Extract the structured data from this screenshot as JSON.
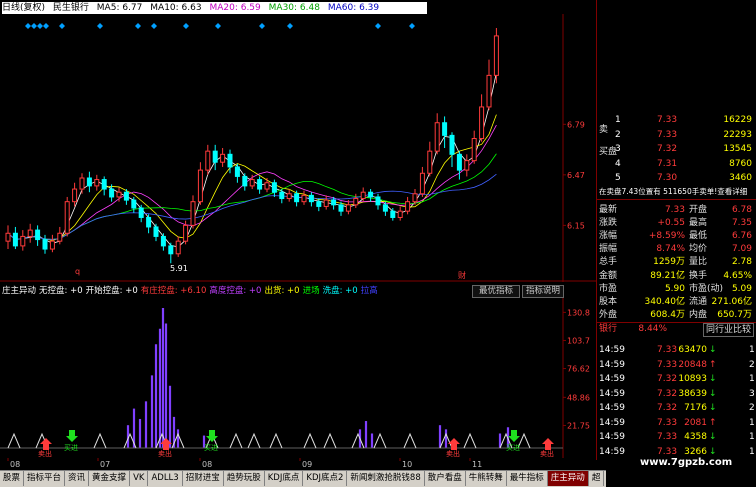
{
  "header": {
    "period": "日线(复权)",
    "stock": "民生银行",
    "ma": [
      {
        "label": "MA5: 6.77",
        "color": "#000000"
      },
      {
        "label": "MA10: 6.63",
        "color": "#000000"
      },
      {
        "label": "MA20: 6.59",
        "color": "#c000c0"
      },
      {
        "label": "MA30: 6.48",
        "color": "#00a000"
      },
      {
        "label": "MA60: 6.39",
        "color": "#0000c0"
      }
    ]
  },
  "main_chart": {
    "price_ticks": [
      "6.79",
      "6.47",
      "6.15"
    ],
    "low_label": "5.91",
    "marker_q": "q",
    "marker_cai": "财"
  },
  "indicator": {
    "items": [
      {
        "label": "庄主异动",
        "color": "#ffffff"
      },
      {
        "label": "无控盘: +0",
        "color": "#ffffff"
      },
      {
        "label": "开始控盘: +0",
        "color": "#ffffff"
      },
      {
        "label": "有庄控盘: +6.10",
        "color": "#ff3b3b"
      },
      {
        "label": "高度控盘: +0",
        "color": "#c040ff"
      },
      {
        "label": "出货: +0",
        "color": "#ffff00"
      },
      {
        "label": "进场",
        "color": "#00ff00"
      },
      {
        "label": "洗盘: +0",
        "color": "#00ffff"
      },
      {
        "label": "拉高",
        "color": "#4040ff"
      }
    ],
    "buttons": [
      "最优指标",
      "指标说明"
    ],
    "y_ticks": [
      "130.8",
      "103.7",
      "76.62",
      "48.86",
      "21.75"
    ],
    "buy_label": "买进",
    "sell_label": "卖出"
  },
  "date_axis": [
    "08",
    "07",
    "08",
    "09",
    "10",
    "11"
  ],
  "quotes": {
    "sell_side_label": "卖",
    "buy_side_label": "买盘",
    "asks": [
      {
        "n": "1",
        "price": "7.33",
        "vol": "16229"
      },
      {
        "n": "2",
        "price": "7.33",
        "vol": "22293"
      },
      {
        "n": "3",
        "price": "7.32",
        "vol": "13545"
      },
      {
        "n": "4",
        "price": "7.31",
        "vol": "8760"
      },
      {
        "n": "5",
        "price": "7.30",
        "vol": "3460"
      }
    ],
    "tick_info": "在卖盘7.43位置有 511650手卖单!查看详细",
    "stats": [
      {
        "l": "最新",
        "v": "7.33",
        "l2": "开盘",
        "v2": "6.78"
      },
      {
        "l": "涨跌",
        "v": "+0.55",
        "l2": "最高",
        "v2": "7.35"
      },
      {
        "l": "涨幅",
        "v": "+8.59%",
        "l2": "最低",
        "v2": "6.76"
      },
      {
        "l": "振幅",
        "v": "8.74%",
        "l2": "均价",
        "v2": "7.09"
      },
      {
        "l": "总手",
        "v": "1259万",
        "l2": "量比",
        "v2": "2.78"
      },
      {
        "l": "金额",
        "v": "89.21亿",
        "l2": "换手",
        "v2": "4.65%"
      },
      {
        "l": "市盈",
        "v": "5.90",
        "l2": "市盈(动)",
        "v2": "5.09"
      },
      {
        "l": "股本",
        "v": "340.40亿",
        "l2": "流通",
        "v2": "271.06亿"
      },
      {
        "l": "外盘",
        "v": "608.4万",
        "l2": "内盘",
        "v2": "650.7万"
      }
    ],
    "sector": {
      "name": "银行",
      "pct": "8.44%",
      "btn": "同行业比较"
    },
    "trades": [
      {
        "t": "14:59",
        "p": "7.33",
        "v": "63470",
        "dir": "down",
        "n": "1"
      },
      {
        "t": "14:59",
        "p": "7.33",
        "v": "20848",
        "dir": "up",
        "n": "2"
      },
      {
        "t": "14:59",
        "p": "7.32",
        "v": "10893",
        "dir": "down",
        "n": "1"
      },
      {
        "t": "14:59",
        "p": "7.32",
        "v": "38639",
        "dir": "down",
        "n": "3"
      },
      {
        "t": "14:59",
        "p": "7.32",
        "v": "7176",
        "dir": "down",
        "n": "2"
      },
      {
        "t": "14:59",
        "p": "7.33",
        "v": "2081",
        "dir": "up",
        "n": "1"
      },
      {
        "t": "14:59",
        "p": "7.33",
        "v": "4358",
        "dir": "down",
        "n": "1"
      },
      {
        "t": "14:59",
        "p": "7.33",
        "v": "3266",
        "dir": "down",
        "n": "1"
      }
    ]
  },
  "bottom_tabs": [
    "股票",
    "指标平台",
    "资讯",
    "黄金支撑",
    "VK",
    "ADLL3",
    "招财进宝",
    "趋势玩股",
    "KDJ底点",
    "KDJ底点2",
    "新闻刺激抢脱钱88",
    "散户看盘",
    "牛熊转舞",
    "最牛指标",
    "庄主异动",
    "超"
  ],
  "active_tab": "庄主异动",
  "watermark": "www.7gpzb.com",
  "colors": {
    "up": "#ff3b3b",
    "down": "#1fe01f",
    "accent": "#800000",
    "volume": "#8040ff"
  },
  "chart_data": {
    "type": "candlestick",
    "y_ticks": [
      6.15,
      6.47,
      6.79
    ],
    "low": 5.91,
    "candles": [
      [
        6.05,
        6.1,
        6.15,
        6.0
      ],
      [
        6.1,
        6.02,
        6.14,
        6.0
      ],
      [
        6.02,
        6.08,
        6.12,
        5.99
      ],
      [
        6.08,
        6.12,
        6.16,
        6.04
      ],
      [
        6.12,
        6.06,
        6.15,
        6.02
      ],
      [
        6.06,
        6.0,
        6.09,
        5.97
      ],
      [
        6.0,
        6.05,
        6.09,
        5.98
      ],
      [
        6.05,
        6.1,
        6.14,
        6.03
      ],
      [
        6.1,
        6.3,
        6.33,
        6.08
      ],
      [
        6.3,
        6.38,
        6.42,
        6.27
      ],
      [
        6.38,
        6.45,
        6.48,
        6.35
      ],
      [
        6.45,
        6.4,
        6.49,
        6.36
      ],
      [
        6.4,
        6.44,
        6.47,
        6.37
      ],
      [
        6.44,
        6.38,
        6.46,
        6.34
      ],
      [
        6.38,
        6.33,
        6.41,
        6.3
      ],
      [
        6.33,
        6.36,
        6.39,
        6.3
      ],
      [
        6.36,
        6.31,
        6.38,
        6.28
      ],
      [
        6.31,
        6.26,
        6.33,
        6.23
      ],
      [
        6.26,
        6.2,
        6.28,
        6.17
      ],
      [
        6.2,
        6.14,
        6.22,
        6.1
      ],
      [
        6.14,
        6.08,
        6.16,
        6.05
      ],
      [
        6.08,
        6.02,
        6.1,
        5.99
      ],
      [
        6.02,
        5.97,
        6.04,
        5.91
      ],
      [
        5.97,
        6.05,
        6.08,
        5.95
      ],
      [
        6.05,
        6.15,
        6.18,
        6.03
      ],
      [
        6.15,
        6.3,
        6.34,
        6.13
      ],
      [
        6.3,
        6.5,
        6.55,
        6.28
      ],
      [
        6.5,
        6.62,
        6.66,
        6.47
      ],
      [
        6.62,
        6.55,
        6.66,
        6.5
      ],
      [
        6.55,
        6.6,
        6.64,
        6.52
      ],
      [
        6.6,
        6.52,
        6.63,
        6.48
      ],
      [
        6.52,
        6.46,
        6.54,
        6.42
      ],
      [
        6.46,
        6.4,
        6.48,
        6.37
      ],
      [
        6.4,
        6.44,
        6.47,
        6.38
      ],
      [
        6.44,
        6.38,
        6.46,
        6.35
      ],
      [
        6.38,
        6.42,
        6.45,
        6.36
      ],
      [
        6.42,
        6.36,
        6.44,
        6.33
      ],
      [
        6.36,
        6.32,
        6.38,
        6.29
      ],
      [
        6.32,
        6.35,
        6.38,
        6.3
      ],
      [
        6.35,
        6.3,
        6.37,
        6.27
      ],
      [
        6.3,
        6.34,
        6.37,
        6.28
      ],
      [
        6.34,
        6.3,
        6.36,
        6.27
      ],
      [
        6.3,
        6.27,
        6.32,
        6.24
      ],
      [
        6.27,
        6.31,
        6.34,
        6.25
      ],
      [
        6.31,
        6.28,
        6.33,
        6.25
      ],
      [
        6.28,
        6.24,
        6.3,
        6.21
      ],
      [
        6.24,
        6.28,
        6.31,
        6.22
      ],
      [
        6.28,
        6.32,
        6.35,
        6.26
      ],
      [
        6.32,
        6.36,
        6.39,
        6.3
      ],
      [
        6.36,
        6.33,
        6.38,
        6.3
      ],
      [
        6.33,
        6.28,
        6.35,
        6.25
      ],
      [
        6.28,
        6.24,
        6.3,
        6.21
      ],
      [
        6.24,
        6.2,
        6.26,
        6.18
      ],
      [
        6.2,
        6.24,
        6.27,
        6.18
      ],
      [
        6.24,
        6.3,
        6.33,
        6.22
      ],
      [
        6.3,
        6.35,
        6.38,
        6.28
      ],
      [
        6.35,
        6.48,
        6.52,
        6.33
      ],
      [
        6.48,
        6.62,
        6.68,
        6.46
      ],
      [
        6.62,
        6.8,
        6.86,
        6.6
      ],
      [
        6.8,
        6.72,
        6.84,
        6.64
      ],
      [
        6.72,
        6.6,
        6.74,
        6.52
      ],
      [
        6.6,
        6.5,
        6.62,
        6.44
      ],
      [
        6.5,
        6.56,
        6.6,
        6.46
      ],
      [
        6.56,
        6.7,
        6.75,
        6.54
      ],
      [
        6.7,
        6.9,
        6.98,
        6.68
      ],
      [
        6.9,
        7.1,
        7.2,
        6.88
      ],
      [
        7.1,
        7.35,
        7.4,
        7.05
      ]
    ]
  }
}
